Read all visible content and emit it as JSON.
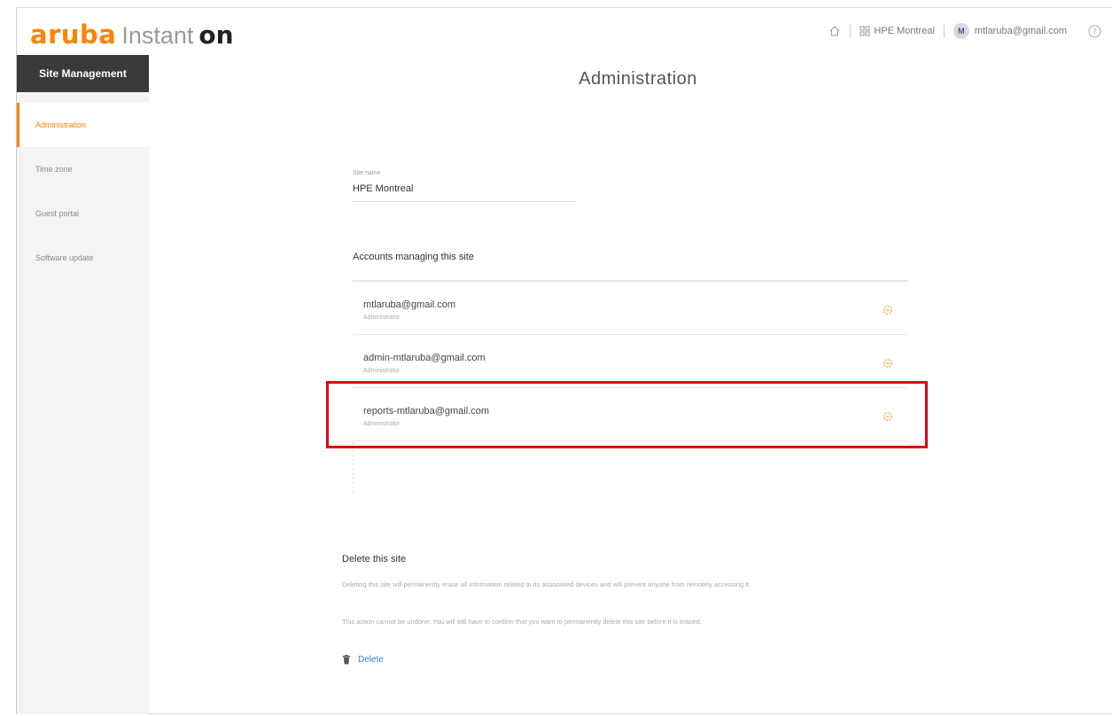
{
  "logo": {
    "brand": "aruba",
    "product": "Instant",
    "product_suffix": "on"
  },
  "header": {
    "home_icon": "home-icon",
    "site_name": "HPE Montreal",
    "user_initial": "M",
    "user_email": "mtlaruba@gmail.com",
    "help_icon": "help-icon"
  },
  "sidebar": {
    "header": "Site Management",
    "items": [
      {
        "label": "Administration",
        "active": true
      },
      {
        "label": "Time zone",
        "active": false
      },
      {
        "label": "Guest portal",
        "active": false
      },
      {
        "label": "Software update",
        "active": false
      }
    ]
  },
  "main": {
    "title": "Administration",
    "site_name_label": "Site name",
    "site_name_value": "HPE Montreal",
    "accounts_title": "Accounts managing this site",
    "accounts": [
      {
        "email": "mtlaruba@gmail.com",
        "role": "Administrator"
      },
      {
        "email": "admin-mtlaruba@gmail.com",
        "role": "Administrator"
      },
      {
        "email": "reports-mtlaruba@gmail.com",
        "role": "Administrator"
      }
    ],
    "delete": {
      "title": "Delete this site",
      "para1": "Deleting this site will permanently erase all information related to its associated devices and will prevent anyone from remotely accessing it.",
      "para2": "This action cannot be undone. You will still have to confirm that you want to permanently delete this site before it is erased.",
      "action_label": "Delete"
    }
  },
  "colors": {
    "accent": "#ff8300",
    "highlight": "#e0000f",
    "link": "#3b7dd8",
    "sidebar_header": "#3a3a3a"
  }
}
